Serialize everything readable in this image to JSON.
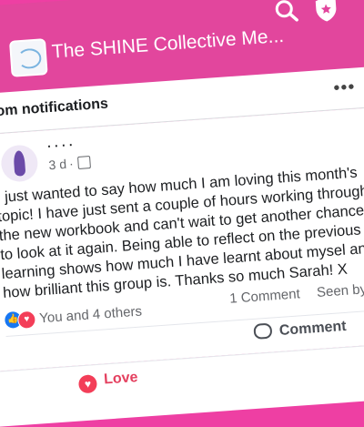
{
  "header": {
    "group_title": "The SHINE Collective Me...",
    "search_icon": "search-icon",
    "shield_icon": "shield-icon"
  },
  "section": {
    "title": "rom notifications",
    "more_label": "•••"
  },
  "post": {
    "author_name": "·  ·  · ·",
    "time": "3 d",
    "separator": "·",
    "body": "I just wanted to say how much I am loving this month's topic! I have just sent a couple of hours working through the new workbook and can't wait to get another chance to look at it again. Being able to reflect on the previous learning shows how much I have learnt about mysel and how brilliant this group is. Thanks so much Sarah! X",
    "reactions_text": "You and 4 others",
    "comment_count": "1 Comment",
    "seen_by": "Seen by",
    "comment_label": "Comment",
    "love_label": "Love"
  },
  "colors": {
    "brand_pink": "#e2469d",
    "love_red": "#e4405f",
    "like_blue": "#1877f2"
  }
}
